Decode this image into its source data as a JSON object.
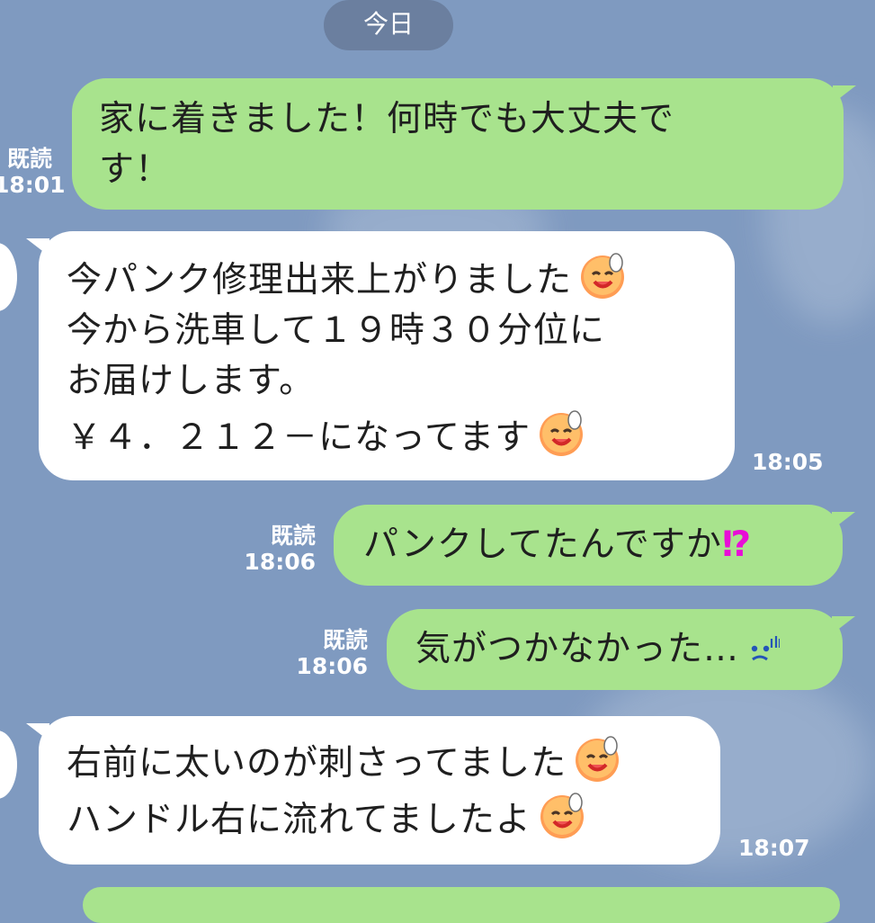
{
  "header": {
    "date_label": "今日"
  },
  "messages": [
    {
      "side": "sent",
      "lines": [
        "家に着きました！何時でも大丈夫で",
        "す！"
      ],
      "status": "既読",
      "time": "18:01"
    },
    {
      "side": "received",
      "lines": [
        "今パンク修理出来上がりました",
        "今から洗車して１９時３０分位に",
        "お届けします。",
        "￥４．２１２－になってます"
      ],
      "time": "18:05"
    },
    {
      "side": "sent",
      "lines": [
        "パンクしてたんですか"
      ],
      "suffix": "⁉",
      "status": "既読",
      "time": "18:06"
    },
    {
      "side": "sent",
      "lines": [
        "気がつかなかった…"
      ],
      "status": "既読",
      "time": "18:06"
    },
    {
      "side": "received",
      "lines": [
        "右前に太いのが刺さってました",
        "ハンドル右に流れてましたよ"
      ],
      "time": "18:07"
    }
  ],
  "colors": {
    "background": "#7f9ac0",
    "sent_bubble": "#a8e38d",
    "received_bubble": "#ffffff",
    "date_pill": "#6b7f9f",
    "accent_punctuation": "#e80dd7"
  },
  "icons": [
    "sweat-smile-emoji-icon",
    "sad-emoji-icon"
  ]
}
